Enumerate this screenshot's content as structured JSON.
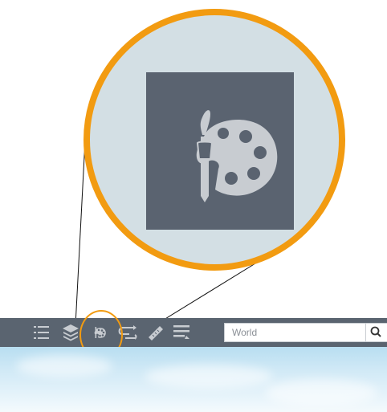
{
  "toolbar": {
    "buttons": [
      {
        "name": "legend-list-button",
        "icon": "list-icon"
      },
      {
        "name": "layers-button",
        "icon": "layers-icon"
      },
      {
        "name": "styles-button",
        "icon": "palette-icon"
      },
      {
        "name": "directions-button",
        "icon": "route-icon"
      },
      {
        "name": "measure-button",
        "icon": "ruler-icon"
      },
      {
        "name": "menu-button",
        "icon": "menu-lines-icon"
      }
    ],
    "search": {
      "placeholder": "World"
    },
    "search_button_icon": "search-icon"
  },
  "magnifier": {
    "icon": "palette-icon",
    "ring_color": "#f29b11",
    "tile_color": "#5a6370",
    "background_color": "#d3dfe4"
  },
  "colors": {
    "toolbar_bg": "#5a6470",
    "icon_fg": "#c8ccd1",
    "accent": "#f29b11"
  }
}
